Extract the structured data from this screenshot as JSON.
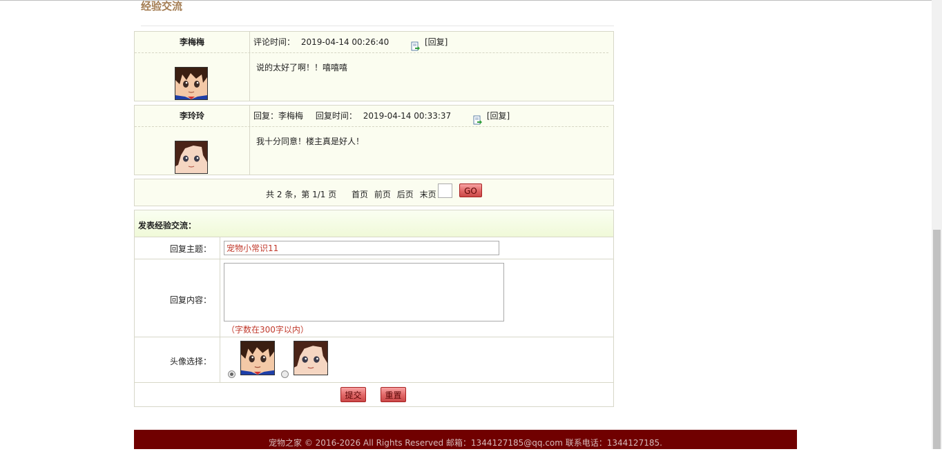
{
  "section": {
    "title": "经验交流"
  },
  "comments": [
    {
      "user": "李梅梅",
      "meta_prefix": "评论时间：",
      "time": "2019-04-14 00:26:40",
      "reply_link": "[回复]",
      "content": "说的太好了啊！！嘻嘻嘻",
      "avatar": "avatar-boy"
    },
    {
      "user": "李玲玲",
      "reply_to_prefix": "回复：",
      "reply_to": "李梅梅",
      "meta_prefix": "回复时间：",
      "time": "2019-04-14 00:33:37",
      "reply_link": "[回复]",
      "content": "我十分同意！楼主真是好人！",
      "avatar": "avatar-girl"
    }
  ],
  "pager": {
    "summary": "共 2 条，第 1/1 页",
    "first": "首页",
    "prev": "前页",
    "next": "后页",
    "last": "末页",
    "page_value": "",
    "go": "GO"
  },
  "form": {
    "title": "发表经验交流：",
    "subject_label": "回复主题：",
    "subject_value": "宠物小常识11",
    "content_label": "回复内容：",
    "content_value": "",
    "content_hint": "（字数在300字以内）",
    "avatar_label": "头像选择：",
    "avatar_options": [
      {
        "name": "avatar-boy",
        "selected": true
      },
      {
        "name": "avatar-girl",
        "selected": false
      }
    ],
    "submit": "提交",
    "reset": "重置"
  },
  "footer": {
    "text": "宠物之家 © 2016-2026 All Rights Reserved 邮箱：1344127185@qq.com 联系电话：1344127185."
  },
  "colors": {
    "footer_bg": "#700000",
    "panel_bg": "#fbfdf0",
    "button_red": "#e06666",
    "hint_red": "#c0392b"
  }
}
